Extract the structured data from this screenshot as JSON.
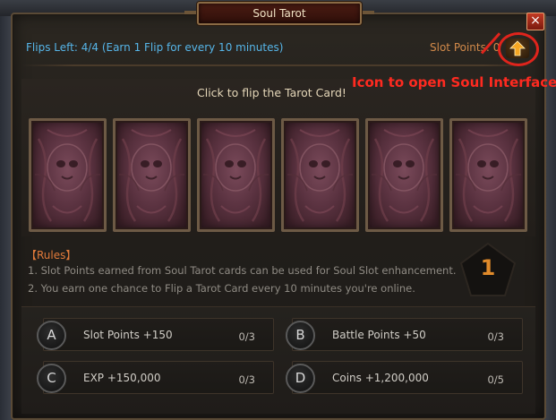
{
  "window": {
    "title": "Soul Tarot",
    "close_glyph": "×"
  },
  "header": {
    "flips_left": "Flips Left: 4/4 (Earn 1 Flip for every 10 minutes)",
    "slot_points": "Slot Points: 0",
    "soul_button_icon": "up-arrow-icon"
  },
  "annotation": {
    "text": "Icon to open Soul Interface",
    "color": "#e0241c"
  },
  "cards": {
    "instruction": "Click to flip the Tarot Card!",
    "items": [
      {
        "state": "face-down"
      },
      {
        "state": "face-down"
      },
      {
        "state": "face-down"
      },
      {
        "state": "face-down"
      },
      {
        "state": "face-down"
      },
      {
        "state": "face-down"
      }
    ]
  },
  "rules": {
    "title": "【Rules】",
    "items": [
      "1. Slot Points earned from Soul Tarot cards can be used for Soul Slot enhancement.",
      "2. You earn one chance to Flip a Tarot Card every 10 minutes you're online."
    ]
  },
  "flip_counter": "1",
  "rewards": [
    {
      "letter": "A",
      "label": "Slot Points +150",
      "count": "0/3"
    },
    {
      "letter": "B",
      "label": "Battle Points +50",
      "count": "0/3"
    },
    {
      "letter": "C",
      "label": "EXP +150,000",
      "count": "0/3"
    },
    {
      "letter": "D",
      "label": "Coins +1,200,000",
      "count": "0/5"
    }
  ],
  "colors": {
    "flips_text": "#56b5e8",
    "slot_points_text": "#d28a4a",
    "rules_title": "#e07a3a",
    "counter": "#e08a2a",
    "annotation": "#ff2a20"
  }
}
